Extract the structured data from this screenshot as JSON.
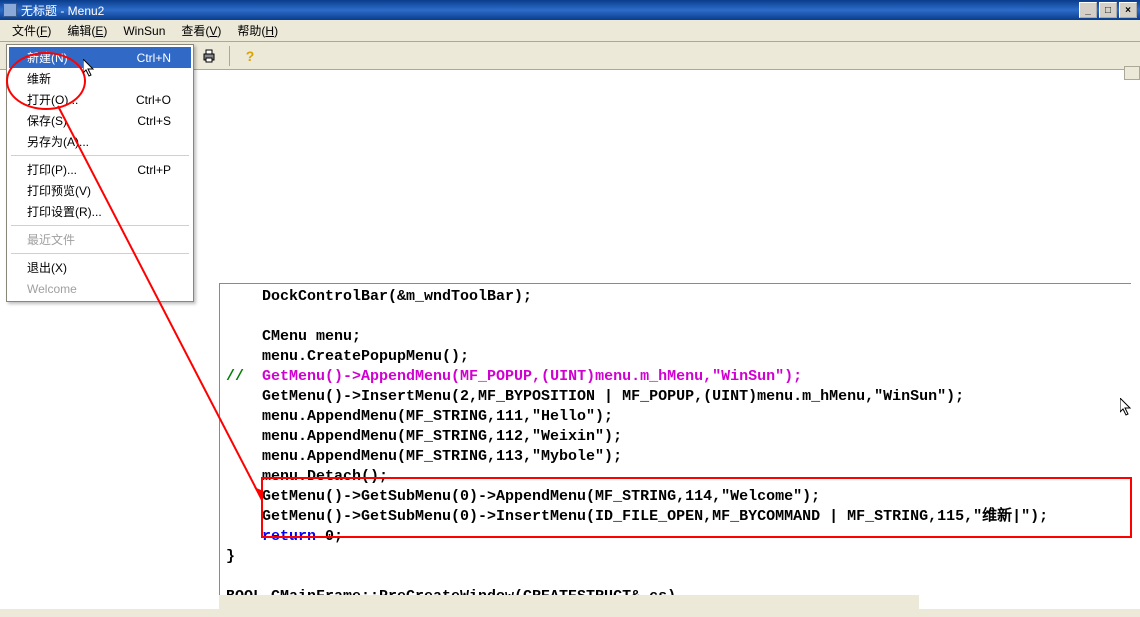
{
  "window": {
    "title": "无标题 - Menu2",
    "min": "_",
    "max": "□",
    "close": "×"
  },
  "menubar": [
    {
      "label": "文件(F)",
      "accel": "F"
    },
    {
      "label": "编辑(E)",
      "accel": "E"
    },
    {
      "label": "WinSun",
      "accel": ""
    },
    {
      "label": "查看(V)",
      "accel": "V"
    },
    {
      "label": "帮助(H)",
      "accel": "H"
    }
  ],
  "dropdown": {
    "groups": [
      [
        {
          "label": "新建(N)",
          "shortcut": "Ctrl+N",
          "selected": true
        },
        {
          "label": "维新",
          "shortcut": "",
          "disabled": false
        },
        {
          "label": "打开(O)...",
          "shortcut": "Ctrl+O"
        },
        {
          "label": "保存(S)",
          "shortcut": "Ctrl+S"
        },
        {
          "label": "另存为(A)...",
          "shortcut": ""
        }
      ],
      [
        {
          "label": "打印(P)...",
          "shortcut": "Ctrl+P"
        },
        {
          "label": "打印预览(V)",
          "shortcut": ""
        },
        {
          "label": "打印设置(R)...",
          "shortcut": ""
        }
      ],
      [
        {
          "label": "最近文件",
          "shortcut": "",
          "disabled": true
        }
      ],
      [
        {
          "label": "退出(X)",
          "shortcut": ""
        },
        {
          "label": "Welcome",
          "shortcut": "",
          "disabled": true
        }
      ]
    ]
  },
  "toolbar": {
    "print_icon": "print-icon",
    "help_icon": "help-icon"
  },
  "code": {
    "l0": "    DockControlBar(&m_wndToolBar);",
    "l1": "",
    "l2": "    CMenu menu;",
    "l3": "    menu.CreatePopupMenu();",
    "l4a": "//  ",
    "l4b": "GetMenu()->AppendMenu(MF_POPUP,(UINT)menu.m_hMenu,\"WinSun\");",
    "l5": "    GetMenu()->InsertMenu(2,MF_BYPOSITION | MF_POPUP,(UINT)menu.m_hMenu,\"WinSun\");",
    "l6": "    menu.AppendMenu(MF_STRING,111,\"Hello\");",
    "l7": "    menu.AppendMenu(MF_STRING,112,\"Weixin\");",
    "l8": "    menu.AppendMenu(MF_STRING,113,\"Mybole\");",
    "l9": "    menu.Detach();",
    "l10": "    GetMenu()->GetSubMenu(0)->AppendMenu(MF_STRING,114,\"Welcome\");",
    "l11": "    GetMenu()->GetSubMenu(0)->InsertMenu(ID_FILE_OPEN,MF_BYCOMMAND | MF_STRING,115,\"维新|\");",
    "l12a": "    ",
    "l12b": "return",
    "l12c": " 0;",
    "l13": "}",
    "l14": "",
    "l15": "BOOL CMainFrame::PreCreateWindow(CREATESTRUCT& cs)",
    "l16": "{"
  }
}
